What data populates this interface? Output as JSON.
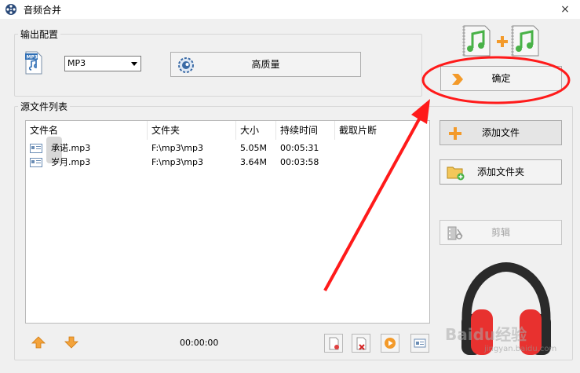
{
  "window": {
    "title": "音频合并",
    "close_glyph": "×"
  },
  "output_group": {
    "label": "输出配置",
    "format_icon_text": "MP3",
    "format_select": {
      "value": "MP3"
    },
    "quality_button": "高质量"
  },
  "confirm_button": "确定",
  "source_group": {
    "label": "源文件列表",
    "columns": [
      "文件名",
      "文件夹",
      "大小",
      "持续时间",
      "截取片断"
    ],
    "rows": [
      {
        "name": "承诺.mp3",
        "folder": "F:\\mp3\\mp3",
        "size": "5.05M",
        "duration": "00:05:31",
        "clip": ""
      },
      {
        "name": "岁月.mp3",
        "folder": "F:\\mp3\\mp3",
        "size": "3.64M",
        "duration": "00:03:58",
        "clip": ""
      }
    ],
    "total_time": "00:00:00"
  },
  "side_buttons": {
    "add_file": "添加文件",
    "add_folder": "添加文件夹",
    "cut": "剪辑"
  },
  "watermark": {
    "text": "Baidu经验",
    "sub": "jingyan.baidu.com"
  },
  "colors": {
    "accent_orange": "#f39a2a",
    "annotation_red": "#ff1a1a",
    "headphone_red": "#e8312f",
    "note_green": "#49b248"
  }
}
